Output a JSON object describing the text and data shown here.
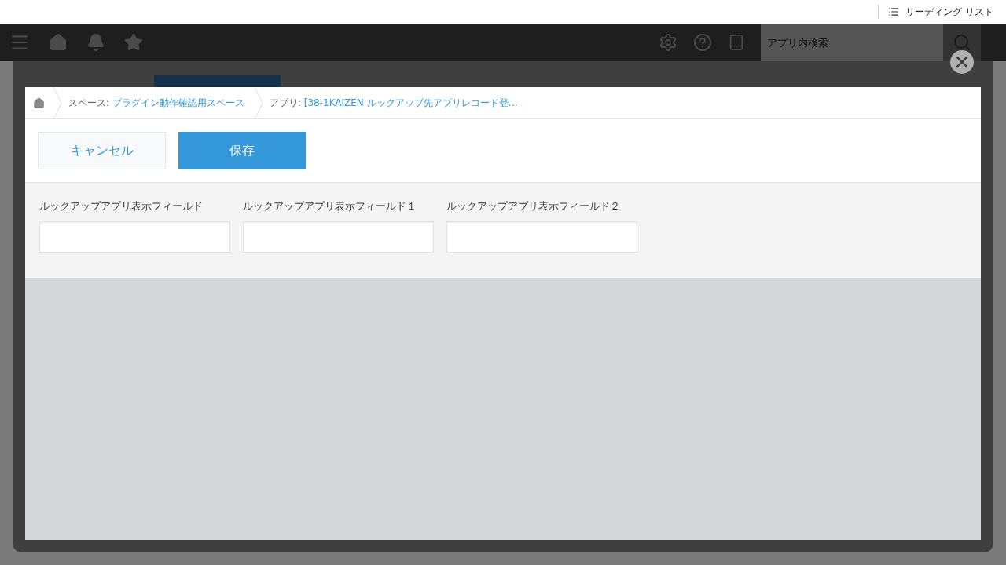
{
  "browser_bar": {
    "reading_list": "リーディング リスト"
  },
  "header": {
    "search": {
      "placeholder": "アプリ内検索"
    }
  },
  "breadcrumb": [
    {
      "prefix": "スペース: ",
      "link": "プラグイン動作確認用スペース"
    },
    {
      "prefix": "アプリ: ",
      "link": "[38-1KAIZEN ルックアップ先アプリレコード登…"
    }
  ],
  "buttons": {
    "cancel": "キャンセル",
    "save": "保存"
  },
  "fields": [
    {
      "label": "ルックアップアプリ表示フィールド"
    },
    {
      "label": "ルックアップアプリ表示フィールド１"
    },
    {
      "label": "ルックアップアプリ表示フィールド２"
    }
  ]
}
